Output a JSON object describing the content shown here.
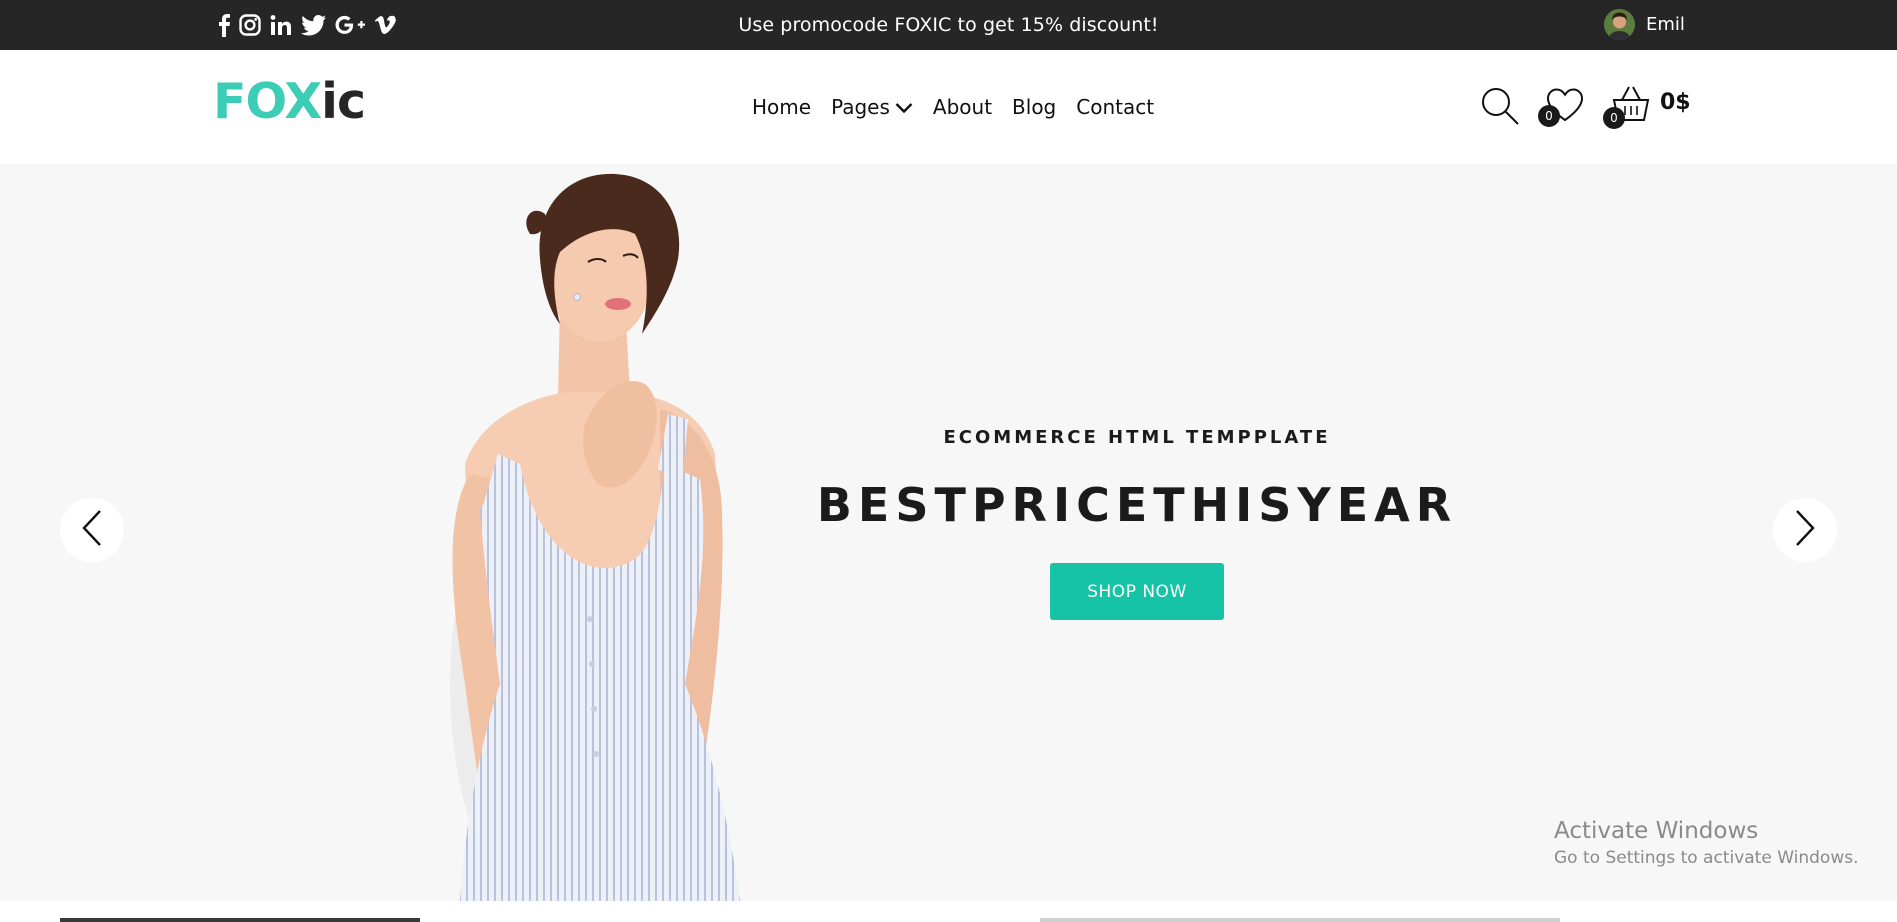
{
  "topbar": {
    "social_icons": [
      "facebook-icon",
      "instagram-icon",
      "linkedin-icon",
      "twitter-icon",
      "google-plus-icon",
      "vimeo-icon"
    ],
    "promo_text": "Use promocode FOXIC to get 15% discount!",
    "user_name": "Emil"
  },
  "header": {
    "logo_part1": "FOX",
    "logo_part2": "ic",
    "nav": [
      "Home",
      "Pages",
      "About",
      "Blog",
      "Contact"
    ],
    "wishlist_count": "0",
    "cart_count": "0",
    "cart_total": "0$"
  },
  "hero": {
    "subtitle": "ECOMMERCE HTML TEMPPLATE",
    "title": "BESTPRICETHISYEAR",
    "button": "SHOP NOW"
  },
  "watermark": {
    "title": "Activate Windows",
    "subtitle": "Go to Settings to activate Windows."
  },
  "colors": {
    "topbar_bg": "#262626",
    "brand_teal": "#3ccdb7",
    "button_teal": "#17c3a7",
    "hero_bg": "#f7f7f7"
  }
}
